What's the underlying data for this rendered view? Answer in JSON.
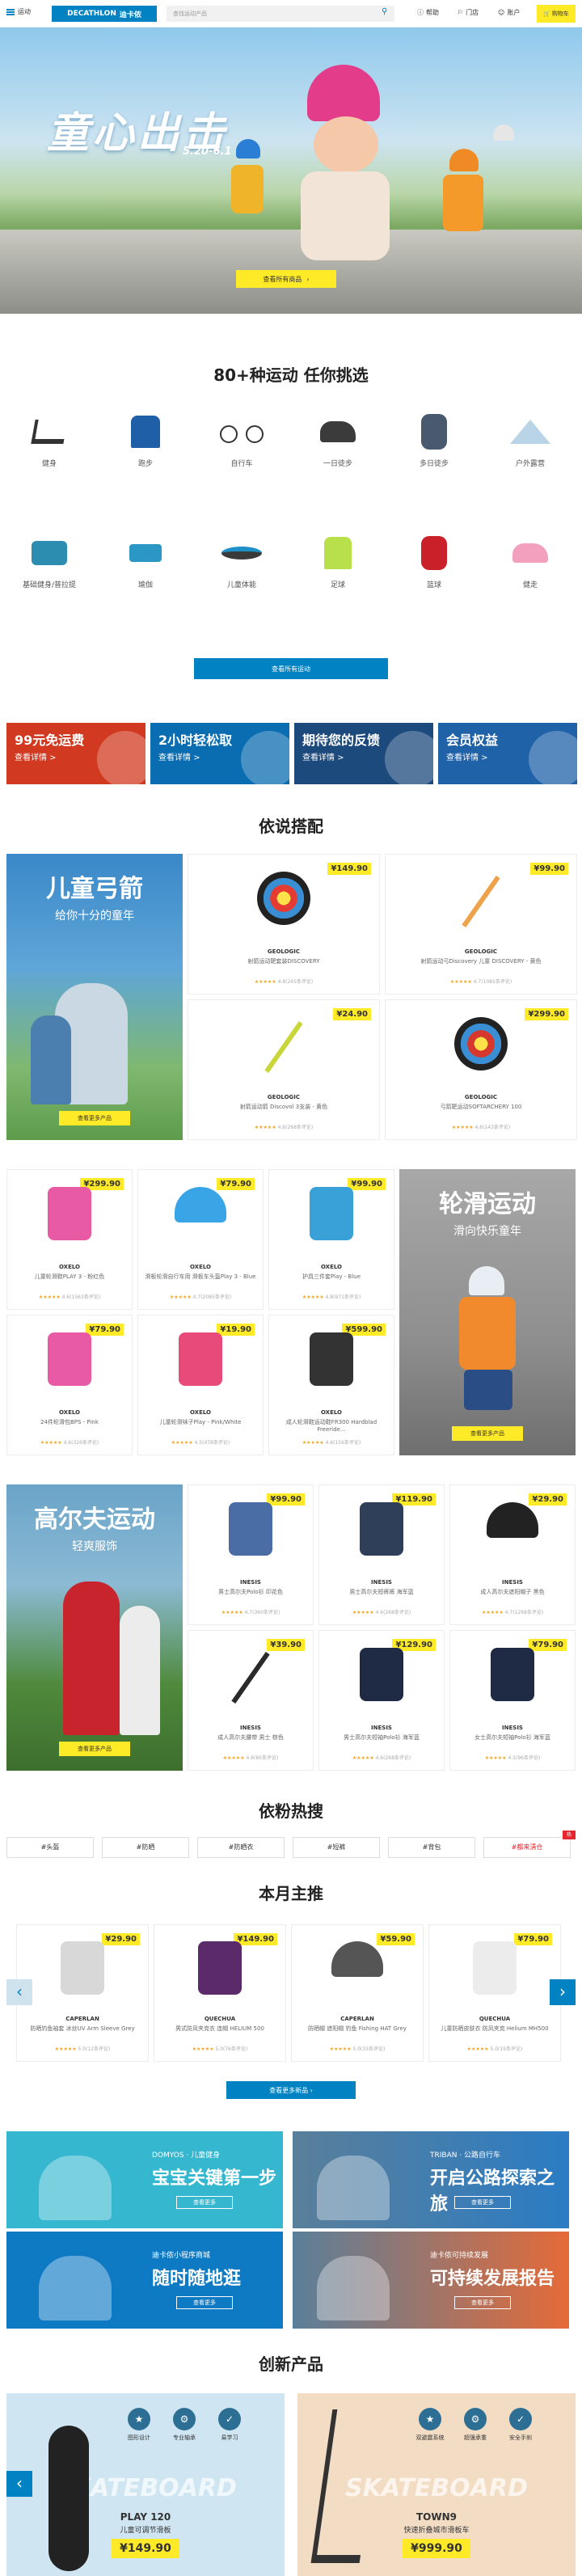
{
  "header": {
    "menu_label": "运动",
    "logo_en": "DECATHLON",
    "logo_cn": "迪卡侬",
    "search_placeholder": "查找运动产品",
    "help_label": "帮助",
    "stores_label": "门店",
    "account_label": "账户",
    "cart_label": "购物车"
  },
  "hero": {
    "title": "童心出击",
    "date": "5.20-6.1",
    "button_label": "查看所有商品"
  },
  "sports": {
    "title": "80+种运动 任你挑选",
    "items": [
      {
        "label": "健身",
        "icon": "treadmill-icon"
      },
      {
        "label": "跑步",
        "icon": "running-shirt-icon"
      },
      {
        "label": "自行车",
        "icon": "bicycle-icon"
      },
      {
        "label": "一日徒步",
        "icon": "hiking-shoe-icon"
      },
      {
        "label": "多日徒步",
        "icon": "backpack-icon"
      },
      {
        "label": "户外露营",
        "icon": "tent-icon"
      },
      {
        "label": "基础健身/普拉提",
        "icon": "yoga-mat-icon"
      },
      {
        "label": "瑜伽",
        "icon": "yoga-block-icon"
      },
      {
        "label": "儿童体能",
        "icon": "trampoline-icon"
      },
      {
        "label": "足球",
        "icon": "football-jersey-icon"
      },
      {
        "label": "篮球",
        "icon": "basketball-icon"
      },
      {
        "label": "健走",
        "icon": "walking-shoe-icon"
      }
    ],
    "button_label": "查看所有运动"
  },
  "promos": [
    {
      "title": "99元免运费",
      "sub": "查看详情 >",
      "color": "#d13a20"
    },
    {
      "title": "2小时轻松取",
      "sub": "查看详情 >",
      "color": "#0b6db1"
    },
    {
      "title": "期待您的反馈",
      "sub": "查看详情 >",
      "color": "#1d4a7c"
    },
    {
      "title": "会员权益",
      "sub": "查看详情 >",
      "color": "#1f62a8"
    }
  ],
  "matching": {
    "title": "依说搭配",
    "archery": {
      "feature_title": "儿童弓箭",
      "feature_sub": "给你十分的童年",
      "feature_button": "查看更多产品",
      "products": [
        {
          "price": "¥149.90",
          "brand": "GEOLOGIC",
          "name": "射箭运动靶套装DISCOVERY",
          "rating": "4.8",
          "reviews": "(245条评论)"
        },
        {
          "price": "¥99.90",
          "brand": "GEOLOGIC",
          "name": "射箭运动弓Discovery 儿童 DISCOVERY - 黄色",
          "rating": "4.7",
          "reviews": "(1085条评论)"
        },
        {
          "price": "¥24.90",
          "brand": "GEOLOGIC",
          "name": "射箭运动箭 Discovol 3支装 - 黄色",
          "rating": "4.6",
          "reviews": "(268条评论)"
        },
        {
          "price": "¥299.90",
          "brand": "GEOLOGIC",
          "name": "弓箭靶运动SOFTARCHERY 100",
          "rating": "4.6",
          "reviews": "(143条评论)"
        }
      ]
    },
    "skating": {
      "feature_title": "轮滑运动",
      "feature_sub": "滑向快乐童年",
      "feature_button": "查看更多产品",
      "products": [
        {
          "price": "¥299.90",
          "brand": "OXELO",
          "name": "儿童轮滑鞋PLAY 3 - 粉红色",
          "rating": "4.6",
          "reviews": "(1563条评论)"
        },
        {
          "price": "¥79.90",
          "brand": "OXELO",
          "name": "滑板轮滑自行车用 滑板车头盔Play 3 - Blue",
          "rating": "4.7",
          "reviews": "(2085条评论)"
        },
        {
          "price": "¥99.90",
          "brand": "OXELO",
          "name": "护具三件套Play - Blue",
          "rating": "4.8",
          "reviews": "(971条评论)"
        },
        {
          "price": "¥79.90",
          "brand": "OXELO",
          "name": "24件轮滑包BPS - Pink",
          "rating": "4.6",
          "reviews": "(326条评论)"
        },
        {
          "price": "¥19.90",
          "brand": "OXELO",
          "name": "儿童轮滑袜子Play - Pink/White",
          "rating": "4.5",
          "reviews": "(478条评论)"
        },
        {
          "price": "¥599.90",
          "brand": "OXELO",
          "name": "成人轮滑鞋运动鞋FR300 Hardblad Freeride...",
          "rating": "4.6",
          "reviews": "(156条评论)"
        }
      ]
    },
    "golf": {
      "feature_title": "高尔夫运动",
      "feature_sub": "轻爽服饰",
      "feature_button": "查看更多产品",
      "products": [
        {
          "price": "¥99.90",
          "brand": "INESIS",
          "name": "男士高尔夫Polo衫 印花色",
          "rating": "4.7",
          "reviews": "(360条评论)"
        },
        {
          "price": "¥119.90",
          "brand": "INESIS",
          "name": "男士高尔夫短裤裤 海军蓝",
          "rating": "4.6",
          "reviews": "(268条评论)"
        },
        {
          "price": "¥29.90",
          "brand": "INESIS",
          "name": "成人高尔夫遮阳帽子 黑色",
          "rating": "4.7",
          "reviews": "(1298条评论)"
        },
        {
          "price": "¥39.90",
          "brand": "INESIS",
          "name": "成人高尔夫腰带 男士 棕色",
          "rating": "4.6",
          "reviews": "(85条评论)"
        },
        {
          "price": "¥129.90",
          "brand": "INESIS",
          "name": "男士高尔夫短袖Polo衫 海军蓝",
          "rating": "4.6",
          "reviews": "(268条评论)"
        },
        {
          "price": "¥79.90",
          "brand": "INESIS",
          "name": "女士高尔夫短袖Polo衫 海军蓝",
          "rating": "4.5",
          "reviews": "(96条评论)"
        }
      ]
    }
  },
  "hot": {
    "title": "依粉热搜",
    "tags": [
      "#头盔",
      "#防晒",
      "#防晒衣",
      "#短裤",
      "#背包",
      "#都来淸仓"
    ],
    "badge": "热"
  },
  "monthly": {
    "title": "本月主推",
    "products": [
      {
        "price": "¥29.90",
        "brand": "CAPERLAN",
        "name": "防晒钓鱼袖套 冰丝UV Arm Sleeve Grey",
        "rating": "5.0",
        "reviews": "(12条评论)"
      },
      {
        "price": "¥149.90",
        "brand": "QUECHUA",
        "name": "男式防风夹克衣 连帽 HELIUM 500",
        "rating": "5.0",
        "reviews": "(76条评论)"
      },
      {
        "price": "¥59.90",
        "brand": "CAPERLAN",
        "name": "防晒帽 遮阳帽 钓鱼 Fishing HAT Grey",
        "rating": "5.0",
        "reviews": "(33条评论)"
      },
      {
        "price": "¥79.90",
        "brand": "QUECHUA",
        "name": "儿童防晒皮肤衣 防风夹克 Helium MH500",
        "rating": "5.0",
        "reviews": "(19条评论)"
      }
    ],
    "button_label": "查看更多新品"
  },
  "banners": [
    {
      "brand": "DOMYOS · 儿童健身",
      "title": "宝宝关键第一步",
      "button": "查看更多",
      "color": "#35b7d0"
    },
    {
      "brand": "TRIBAN · 公路自行车",
      "title": "开启公路探索之旅",
      "button": "查看更多",
      "color": "#2b7cc4"
    },
    {
      "brand": "迪卡侬小程序商城",
      "title": "随时随地逛",
      "button": "查看更多",
      "color": "#0f7ac4"
    },
    {
      "brand": "迪卡侬可持续发展",
      "title": "可持续发展报告",
      "button": "查看更多",
      "color": "#e56a38"
    }
  ],
  "new_products": {
    "title": "创新产品",
    "items": [
      {
        "name": "PLAY 120",
        "sub": "儿童可调节滑板",
        "price": "¥149.90",
        "icons": [
          "图形设计",
          "专业轴承",
          "易学习"
        ],
        "watermark": "SKATEBOARD"
      },
      {
        "name": "TOWN9",
        "sub": "快速折叠城市滑板车",
        "price": "¥999.90",
        "icons": [
          "双避震系统",
          "超强承重",
          "安全手刹"
        ],
        "watermark": "SKATEBOARD"
      }
    ]
  }
}
